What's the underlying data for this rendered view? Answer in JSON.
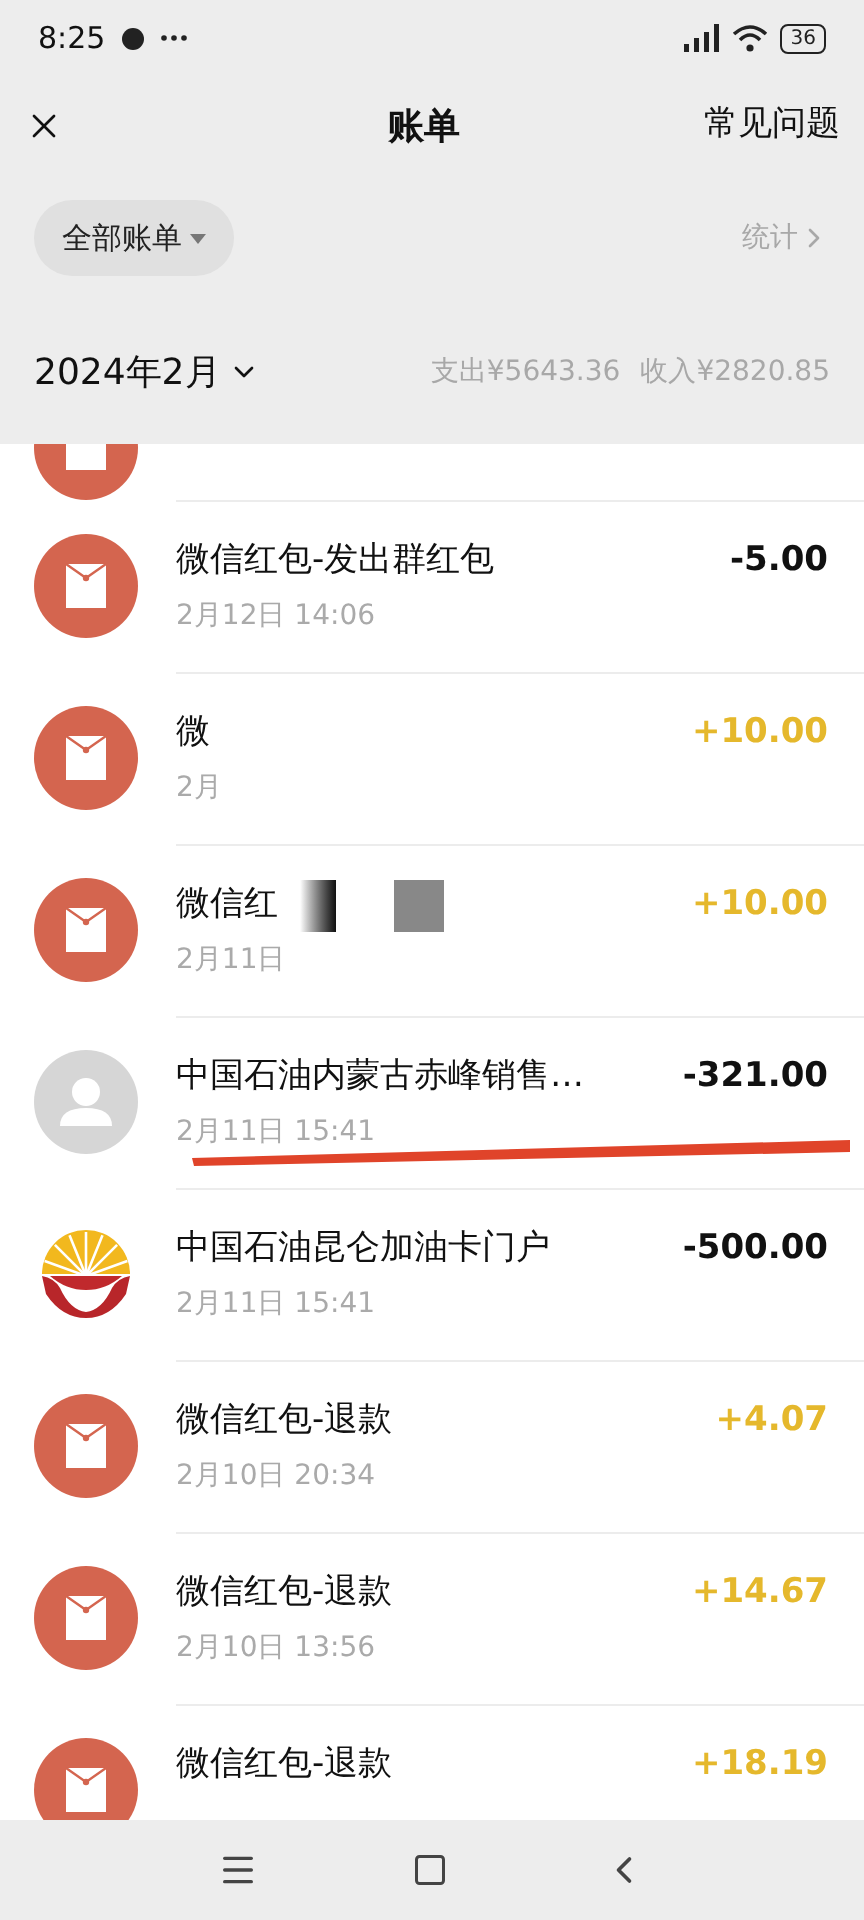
{
  "status_bar": {
    "time": "8:25",
    "battery": "36"
  },
  "nav": {
    "title": "账单",
    "right_link": "常见问题"
  },
  "filter": {
    "chip": "全部账单",
    "stats_link": "统计"
  },
  "month": {
    "label": "2024年2月",
    "expense": "支出¥5643.36",
    "income": "收入¥2820.85"
  },
  "transactions": [
    {
      "kind": "red_packet",
      "title": "微信红包-发出群红包",
      "date": "2月12日 14:06",
      "amount": "-5.00",
      "income": false,
      "redacted": false
    },
    {
      "kind": "red_packet",
      "title": "微",
      "date": "2月",
      "amount": "+10.00",
      "income": true,
      "redacted": false
    },
    {
      "kind": "red_packet",
      "title": "微信红",
      "date": "2月11日",
      "amount": "+10.00",
      "income": true,
      "redacted": true
    },
    {
      "kind": "person",
      "title": "中国石油内蒙古赤峰销售…",
      "date": "2月11日 15:41",
      "amount": "-321.00",
      "income": false,
      "redacted": false
    },
    {
      "kind": "petrochina_logo",
      "title": "中国石油昆仑加油卡门户",
      "date": "2月11日 15:41",
      "amount": "-500.00",
      "income": false,
      "redacted": false
    },
    {
      "kind": "red_packet",
      "title": "微信红包-退款",
      "date": "2月10日 20:34",
      "amount": "+4.07",
      "income": true,
      "redacted": false
    },
    {
      "kind": "red_packet",
      "title": "微信红包-退款",
      "date": "2月10日 13:56",
      "amount": "+14.67",
      "income": true,
      "redacted": false
    },
    {
      "kind": "red_packet",
      "title": "微信红包-退款",
      "amount": "+18.19",
      "income": true,
      "redacted": false
    }
  ]
}
